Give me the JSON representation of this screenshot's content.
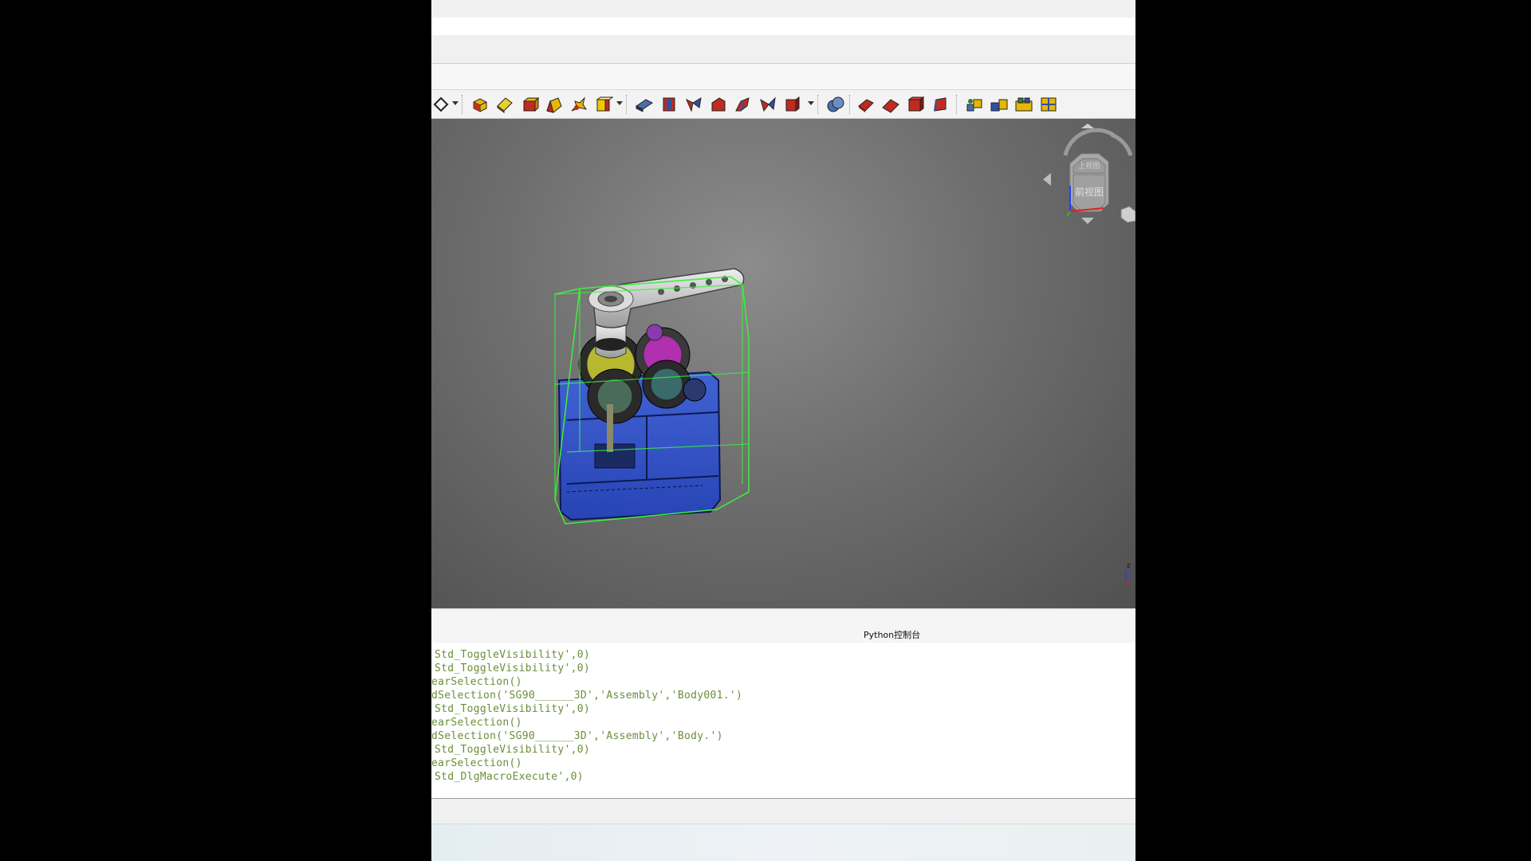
{
  "toolbar": {
    "tools": [
      {
        "name": "sketch-tool"
      },
      {
        "name": "box-tool"
      },
      {
        "name": "cylinder-tool"
      },
      {
        "name": "cone-tool"
      },
      {
        "name": "sphere-tool"
      },
      {
        "name": "torus-tool"
      },
      {
        "name": "tube-tool"
      },
      {
        "name": "extrude-tool"
      },
      {
        "name": "revolve-tool"
      },
      {
        "name": "mirror-tool"
      },
      {
        "name": "fillet-tool"
      },
      {
        "name": "chamfer-tool"
      },
      {
        "name": "make-face-tool"
      },
      {
        "name": "ruled-surface-tool"
      },
      {
        "name": "loft-tool"
      },
      {
        "name": "boolean-tool"
      },
      {
        "name": "cut-tool"
      },
      {
        "name": "fuse-tool"
      },
      {
        "name": "common-tool"
      },
      {
        "name": "section-tool"
      },
      {
        "name": "compound-tool"
      },
      {
        "name": "explode-compound-tool"
      },
      {
        "name": "check-geometry-tool"
      },
      {
        "name": "measure-tool"
      }
    ]
  },
  "navcube": {
    "top_label": "上视图",
    "front_label": "前视图"
  },
  "axis_label": "Z",
  "console": {
    "title": "Python控制台",
    "lines": [
      "Std_ToggleVisibility',0)",
      "Std_ToggleVisibility',0)",
      "earSelection()",
      "dSelection('SG90______3D','Assembly','Body001.')",
      "Std_ToggleVisibility',0)",
      "earSelection()",
      "dSelection('SG90______3D','Assembly','Body.')",
      "Std_ToggleVisibility',0)",
      "earSelection()",
      "Std_DlgMacroExecute',0)"
    ]
  }
}
